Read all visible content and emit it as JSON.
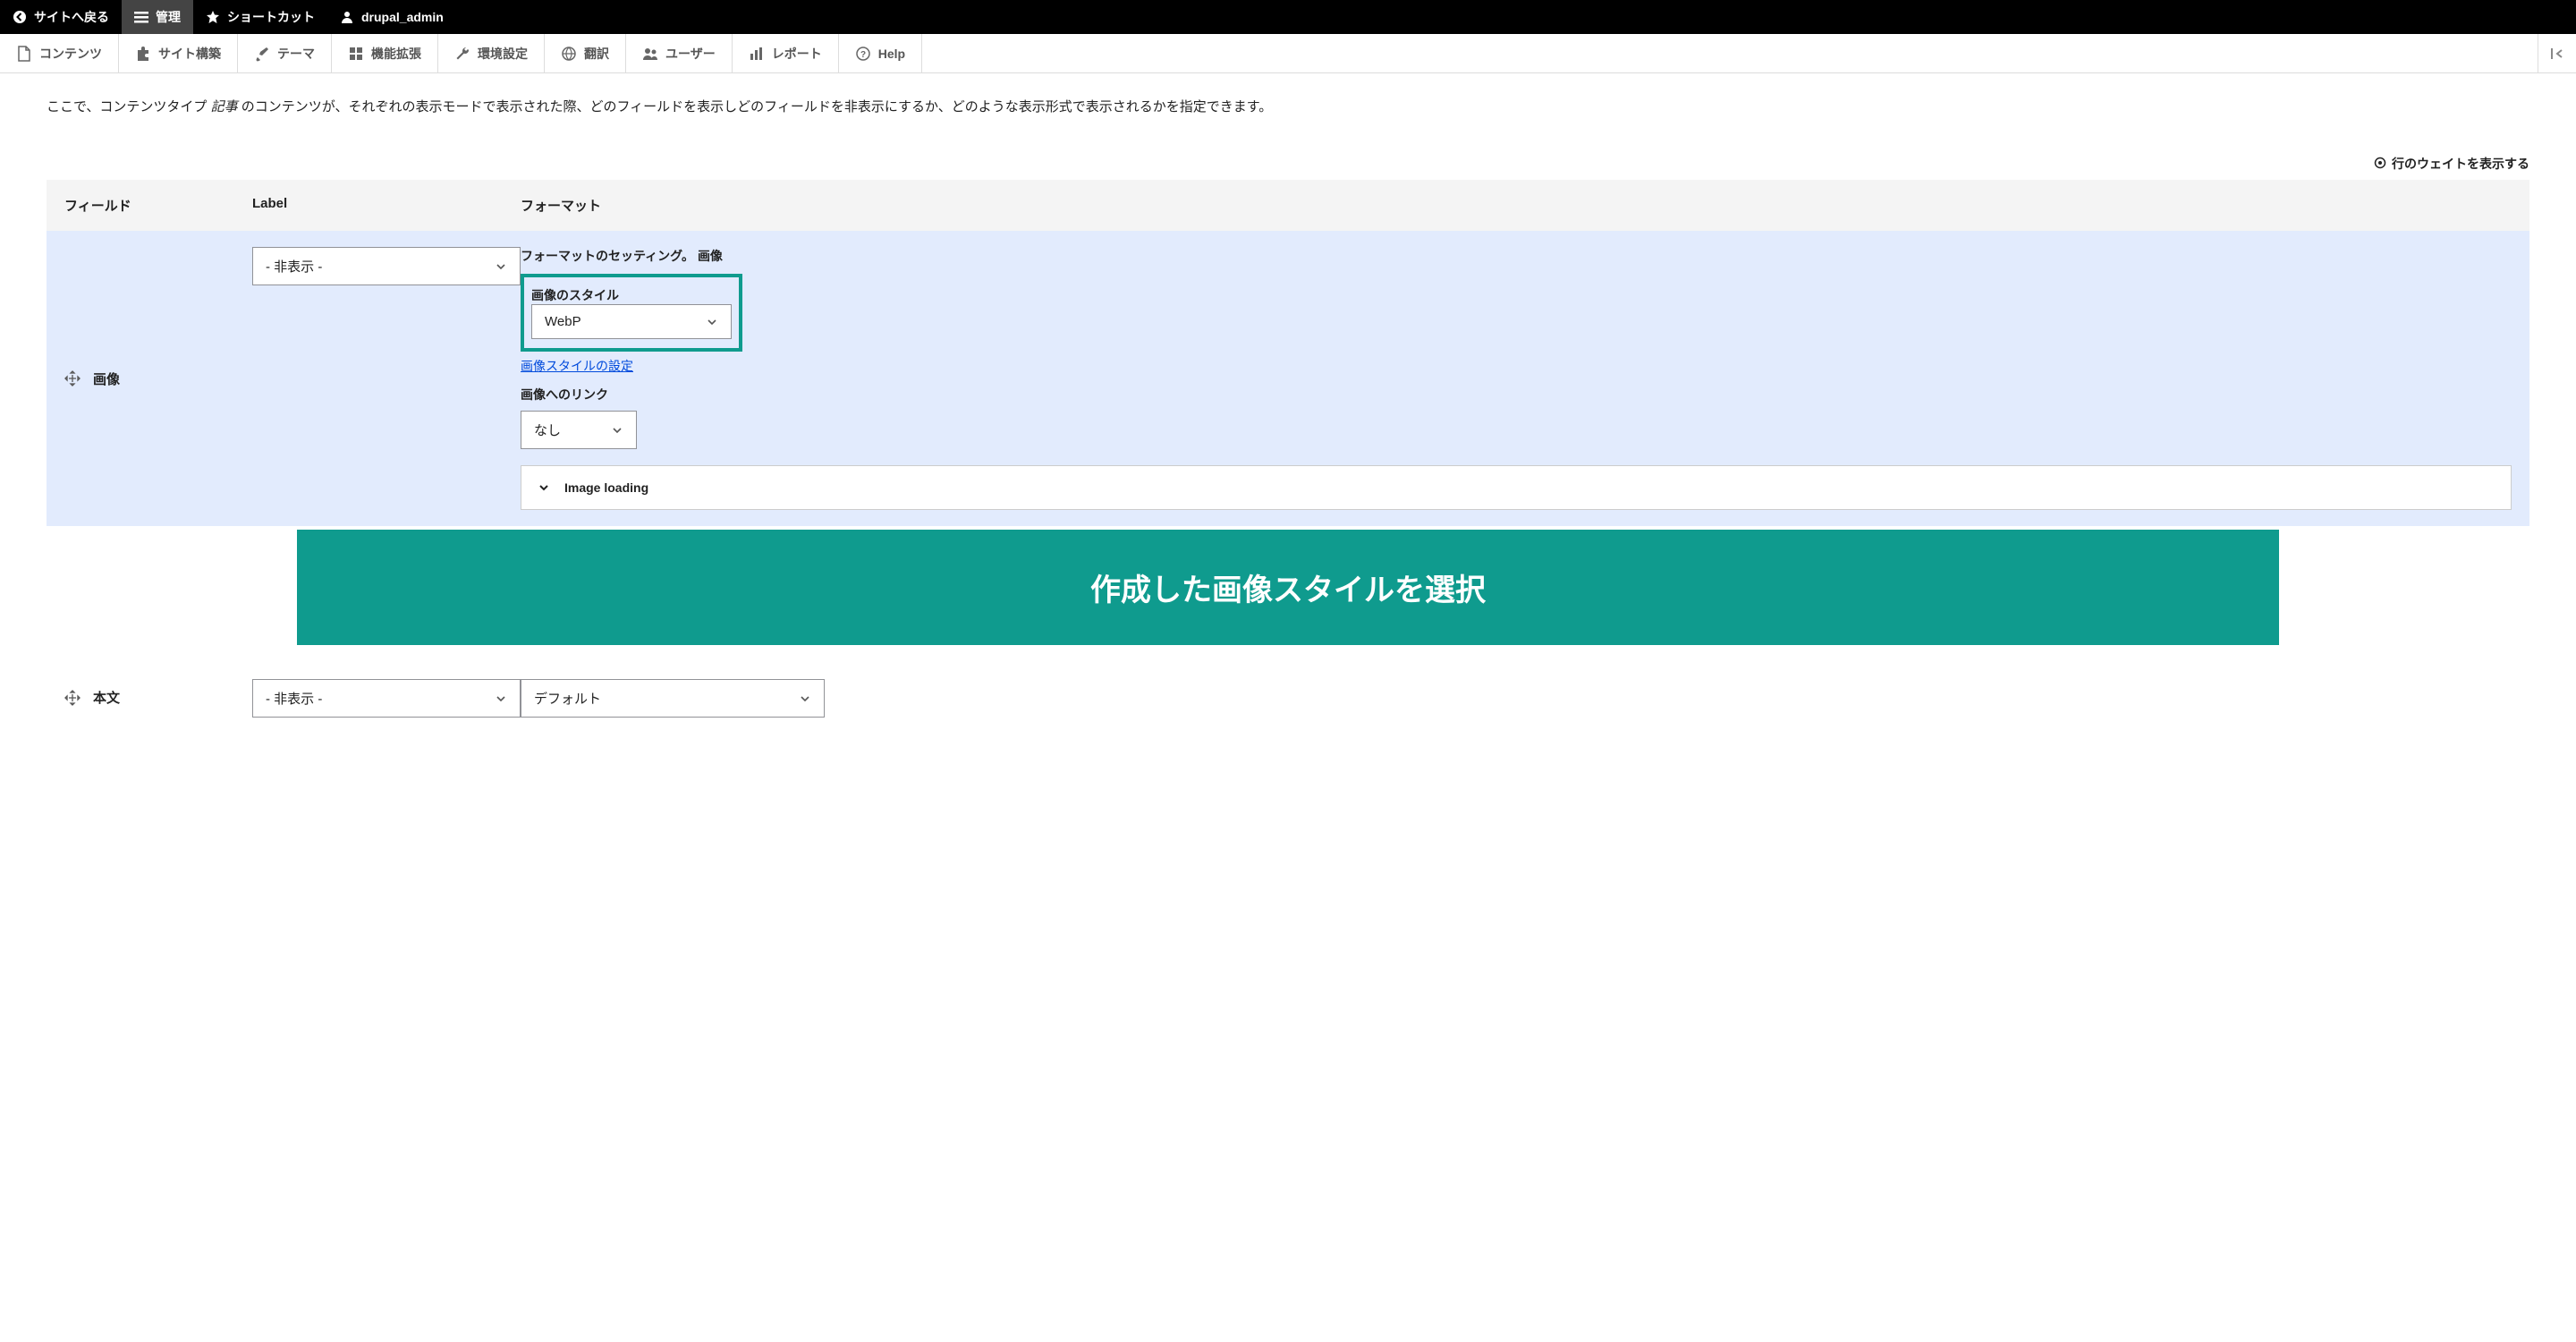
{
  "toolbar_top": {
    "back": "サイトへ戻る",
    "manage": "管理",
    "shortcuts": "ショートカット",
    "user": "drupal_admin"
  },
  "toolbar_sec": {
    "content": "コンテンツ",
    "structure": "サイト構築",
    "theme": "テーマ",
    "extend": "機能拡張",
    "config": "環境設定",
    "translate": "翻訳",
    "users": "ユーザー",
    "reports": "レポート",
    "help": "Help"
  },
  "intro_pre": "ここで、コンテンツタイプ ",
  "intro_em": "記事",
  "intro_post": " のコンテンツが、それぞれの表示モードで表示された際、どのフィールドを表示しどのフィールドを非表示にするか、どのような表示形式で表示されるかを指定できます。",
  "weights_link": "行のウェイトを表示する",
  "headers": {
    "field": "フィールド",
    "label": "Label",
    "format": "フォーマット"
  },
  "row_image": {
    "name": "画像",
    "label_value": "- 非表示 -",
    "format_settings_label": "フォーマットのセッティング。",
    "format_settings_em": "画像",
    "style_label": "画像のスタイル",
    "style_value": "WebP",
    "style_config_link": "画像スタイルの設定",
    "link_label": "画像へのリンク",
    "link_value": "なし",
    "accordion": "Image loading"
  },
  "annotation": "作成した画像スタイルを選択",
  "row_body": {
    "name": "本文",
    "label_value": "- 非表示 -",
    "format_value": "デフォルト"
  }
}
